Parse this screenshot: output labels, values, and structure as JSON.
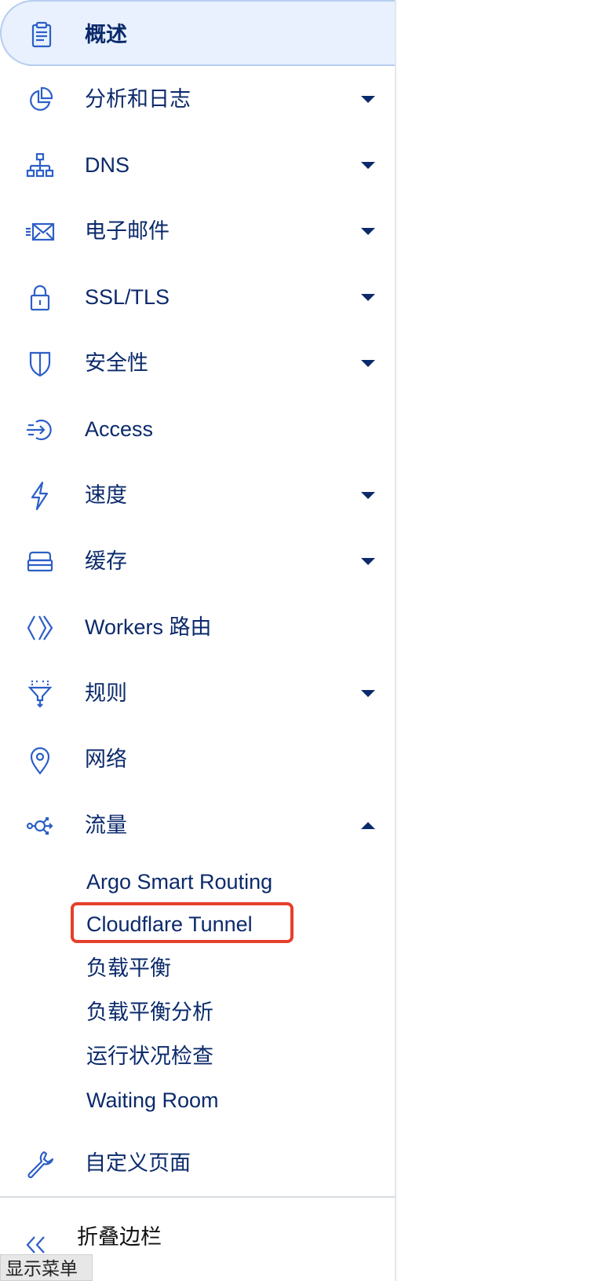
{
  "sidebar": {
    "items": [
      {
        "label": "概述",
        "icon": "overview-icon",
        "active": true
      },
      {
        "label": "分析和日志",
        "icon": "analytics-icon",
        "expandable": true
      },
      {
        "label": "DNS",
        "icon": "dns-icon",
        "expandable": true
      },
      {
        "label": "电子邮件",
        "icon": "email-icon",
        "expandable": true
      },
      {
        "label": "SSL/TLS",
        "icon": "lock-icon",
        "expandable": true
      },
      {
        "label": "安全性",
        "icon": "shield-icon",
        "expandable": true
      },
      {
        "label": "Access",
        "icon": "access-icon"
      },
      {
        "label": "速度",
        "icon": "lightning-icon",
        "expandable": true
      },
      {
        "label": "缓存",
        "icon": "cache-icon",
        "expandable": true
      },
      {
        "label": "Workers 路由",
        "icon": "workers-icon"
      },
      {
        "label": "规则",
        "icon": "rules-icon",
        "expandable": true
      },
      {
        "label": "网络",
        "icon": "location-pin-icon"
      },
      {
        "label": "流量",
        "icon": "traffic-icon",
        "expandable": true,
        "expanded": true
      }
    ],
    "traffic_subitems": [
      {
        "label": "Argo Smart Routing"
      },
      {
        "label": "Cloudflare Tunnel",
        "highlighted": true
      },
      {
        "label": "负载平衡"
      },
      {
        "label": "负载平衡分析"
      },
      {
        "label": "运行状况检查"
      },
      {
        "label": "Waiting Room"
      }
    ],
    "custom_pages": {
      "label": "自定义页面",
      "icon": "wrench-icon"
    },
    "collapse_label": "折叠边栏"
  },
  "show_menu_label": "显示菜单",
  "colors": {
    "text": "#0b2a6b",
    "icon": "#2c5fc7",
    "active_bg": "#e8f1fd",
    "active_border": "#b6cdf0",
    "highlight": "#e5402b"
  }
}
